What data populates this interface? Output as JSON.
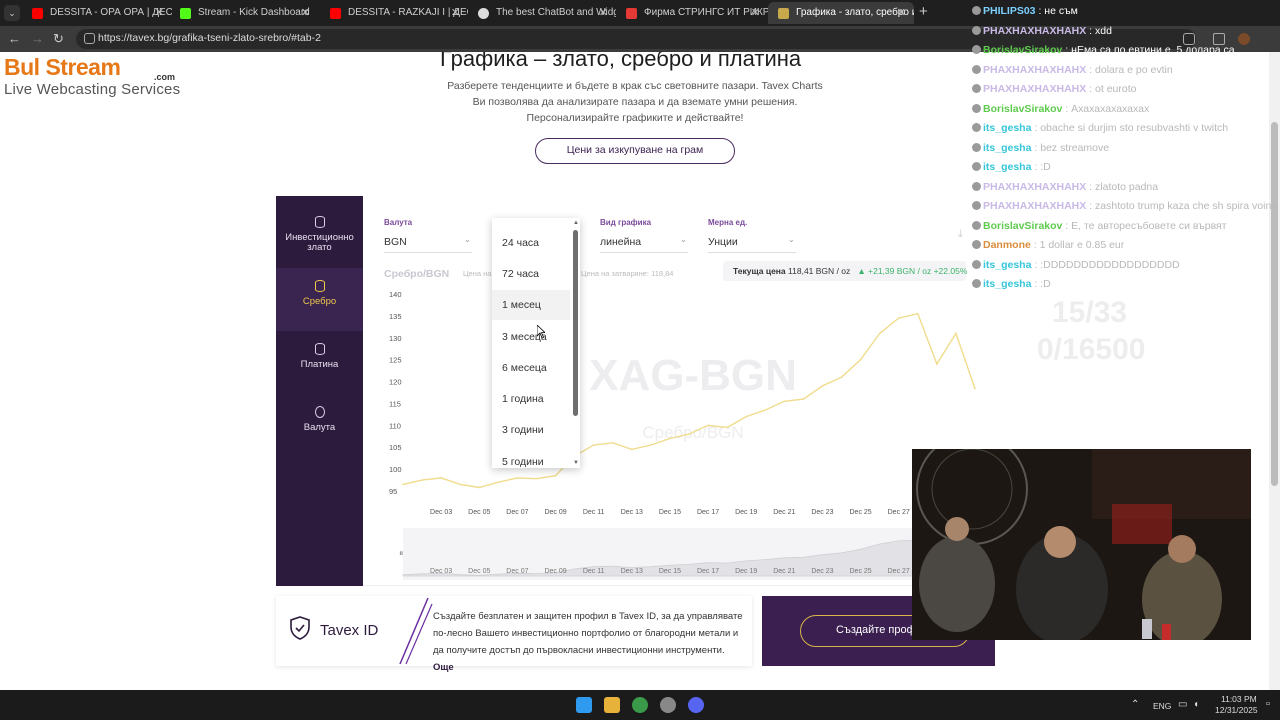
{
  "browser": {
    "tabs": [
      {
        "title": "DESSITA - ОРА ОРА | ДЕСИТА",
        "favicon": "youtube-icon",
        "color": "#ff0000"
      },
      {
        "title": "Stream - Kick Dashboard",
        "favicon": "kick-icon",
        "color": "#53fc18"
      },
      {
        "title": "DESSITA - RAZKAJI I | ДЕСИ",
        "favicon": "youtube-icon",
        "color": "#ff0000"
      },
      {
        "title": "The best ChatBot and Widgets",
        "favicon": "chatbot-icon",
        "color": "#dddddd"
      },
      {
        "title": "Фирма СТРИНГС ИТ РИКРУТМ",
        "favicon": "firm-icon",
        "color": "#e53935"
      },
      {
        "title": "Графика - злато, сребро и пла",
        "favicon": "tavex-icon",
        "color": "#c7a94c"
      }
    ],
    "url": "https://tavex.bg/grafika-tseni-zlato-srebro/#tab-2"
  },
  "logo": {
    "main": "Bul Stream",
    "dotcom": ".com",
    "sub": "Live Webcasting Services"
  },
  "hero": {
    "title": "Графика – злато, сребро и платина",
    "text": "Разберете тенденциите и бъдете в крак със световните пазари. Tavex Charts Ви позволява да анализирате пазара и да вземате умни решения. Персонализирайте графиките и действайте!",
    "cta": "Цени за изкупуване на грам"
  },
  "sidebar": {
    "items": [
      {
        "label": "Инвестиционно злато",
        "icon": "coins-icon"
      },
      {
        "label": "Сребро",
        "icon": "coins-icon",
        "active": true
      },
      {
        "label": "Платина",
        "icon": "coins-icon"
      },
      {
        "label": "Валута",
        "icon": "currency-exchange-icon"
      }
    ]
  },
  "controls": {
    "currency": {
      "label": "Валута",
      "value": "BGN"
    },
    "chart_type": {
      "label": "Вид графика",
      "value": "линейна"
    },
    "unit": {
      "label": "Мерна ед.",
      "value": "Унции"
    }
  },
  "chart_header": {
    "pair": "Сребро/BGN",
    "price_hint_left": "Цена на",
    "price_hint_right": "Цена на затваряне: 118,84",
    "current_label": "Текуща цена",
    "current_value": "118,41 BGN / oz",
    "change": "+21,39 BGN / oz +22.05%"
  },
  "period_dropdown": {
    "options": [
      "24 часа",
      "72 часа",
      "1 месец",
      "3 месеца",
      "6 месеца",
      "1 година",
      "3 години",
      "5 години"
    ],
    "hovered": "1 месец"
  },
  "chart_data": {
    "type": "line",
    "title": "Сребро/BGN",
    "watermark": "XAG-BGN",
    "watermark_sub": "Сребро/BGN",
    "xlabel": "",
    "ylabel": "",
    "ylim": [
      95,
      140
    ],
    "yticks": [
      "140",
      "135",
      "130",
      "125",
      "120",
      "115",
      "110",
      "105",
      "100",
      "95"
    ],
    "x_tick_labels": [
      "Dec 03",
      "Dec 05",
      "Dec 07",
      "Dec 09",
      "Dec 11",
      "Dec 13",
      "Dec 15",
      "Dec 17",
      "Dec 19",
      "Dec 21",
      "Dec 23",
      "Dec 25",
      "Dec 27"
    ],
    "series": [
      {
        "color": "#f0dc8c",
        "x": [
          "Dec 01",
          "Dec 02",
          "Dec 03",
          "Dec 04",
          "Dec 05",
          "Dec 06",
          "Dec 07",
          "Dec 08",
          "Dec 09",
          "Dec 10",
          "Dec 11",
          "Dec 12",
          "Dec 13",
          "Dec 14",
          "Dec 15",
          "Dec 16",
          "Dec 17",
          "Dec 18",
          "Dec 19",
          "Dec 20",
          "Dec 21",
          "Dec 22",
          "Dec 23",
          "Dec 24",
          "Dec 25",
          "Dec 26",
          "Dec 27",
          "Dec 28",
          "Dec 29",
          "Dec 30",
          "Dec 31"
        ],
        "values": [
          96.5,
          97.5,
          98.0,
          96.5,
          95.8,
          97.0,
          98.0,
          97.8,
          98.5,
          103.0,
          105.5,
          106.0,
          104.5,
          105.5,
          107.0,
          108.0,
          110.0,
          109.5,
          112.0,
          113.5,
          115.5,
          116.0,
          119.0,
          121.0,
          125.0,
          131.0,
          134.5,
          135.5,
          124.0,
          131.0,
          118.4
        ]
      }
    ],
    "grid": false,
    "legend": "none"
  },
  "tavex_id": {
    "title": "Tavex ID",
    "text": "Създайте безплатен и защитен профил в Tavex ID, за да управлявате по-лесно Вашето инвестиционно портфолио от благородни метали и да получите достъп до първокласни инвестиционни инструменти.",
    "more": "Още",
    "button": "Създайте профил"
  },
  "chat": {
    "messages": [
      {
        "name": "PHILIPS03",
        "text": "не съм",
        "cls": "n-philips",
        "strong": true
      },
      {
        "name": "PHAXHAXHAXHAHX",
        "text": "xdd",
        "cls": "n-phx",
        "strong": true
      },
      {
        "name": "BorislavSirakov",
        "text": "нЕма са по евтини е. 5 долара са",
        "cls": "n-borislav",
        "strong": true
      },
      {
        "name": "PHAXHAXHAXHAHX",
        "text": "dolara e po evtin",
        "cls": "n-phx"
      },
      {
        "name": "PHAXHAXHAXHAHX",
        "text": "ot euroto",
        "cls": "n-phx"
      },
      {
        "name": "BorislavSirakov",
        "text": "Ахахахахахахах",
        "cls": "n-borislav"
      },
      {
        "name": "its_gesha",
        "text": "obache si durjim sto resubvashti v twitch",
        "cls": "n-itsgesha"
      },
      {
        "name": "its_gesha",
        "text": "bez streamove",
        "cls": "n-itsgesha"
      },
      {
        "name": "its_gesha",
        "text": ":D",
        "cls": "n-itsgesha"
      },
      {
        "name": "PHAXHAXHAXHAHX",
        "text": "zlatoto padna",
        "cls": "n-phx"
      },
      {
        "name": "PHAXHAXHAXHAHX",
        "text": "zashtoto trump kaza che sh spira voina",
        "cls": "n-phx"
      },
      {
        "name": "BorislavSirakov",
        "text": "Е, те авторесъбовете си вървят",
        "cls": "n-borislav"
      },
      {
        "name": "Danmone",
        "text": "1 dollar e 0.85 eur",
        "cls": "n-danmone"
      },
      {
        "name": "its_gesha",
        "text": ":DDDDDDDDDDDDDDDDDD",
        "cls": "n-itsgesha"
      },
      {
        "name": "its_gesha",
        "text": ":D",
        "cls": "n-itsgesha"
      }
    ],
    "counter_1": "15/33",
    "counter_2": "0/16500"
  },
  "taskbar": {
    "lang": "ENG",
    "time": "11:03 PM",
    "date": "12/31/2025"
  }
}
